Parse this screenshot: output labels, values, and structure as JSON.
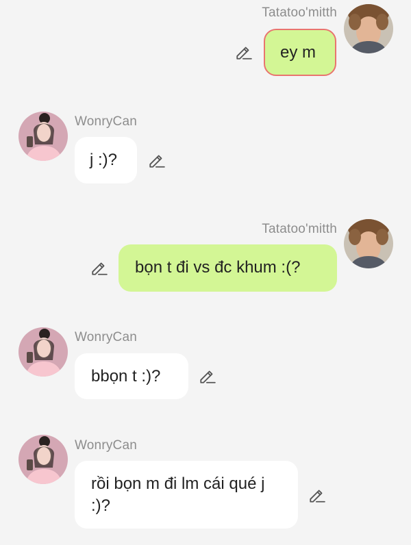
{
  "messages": [
    {
      "sender": "Tatatoo'mitth",
      "text": "ey m",
      "side": "right"
    },
    {
      "sender": "WonryCan",
      "text": "j :)?",
      "side": "left"
    },
    {
      "sender": "Tatatoo'mitth",
      "text": "bọn t đi vs đc khum :(?",
      "side": "right"
    },
    {
      "sender": "WonryCan",
      "text": "bbọn t :)?",
      "side": "left"
    },
    {
      "sender": "WonryCan",
      "text": "rồi bọn m đi lm cái qué j :)?",
      "side": "left"
    }
  ],
  "colors": {
    "background": "#f4f4f4",
    "my_bubble": "#d3f695",
    "other_bubble": "#ffffff",
    "highlight_border": "#e9746f",
    "name_text": "#8d8d8d"
  },
  "icons": {
    "edit": "pencil-edit-icon"
  }
}
